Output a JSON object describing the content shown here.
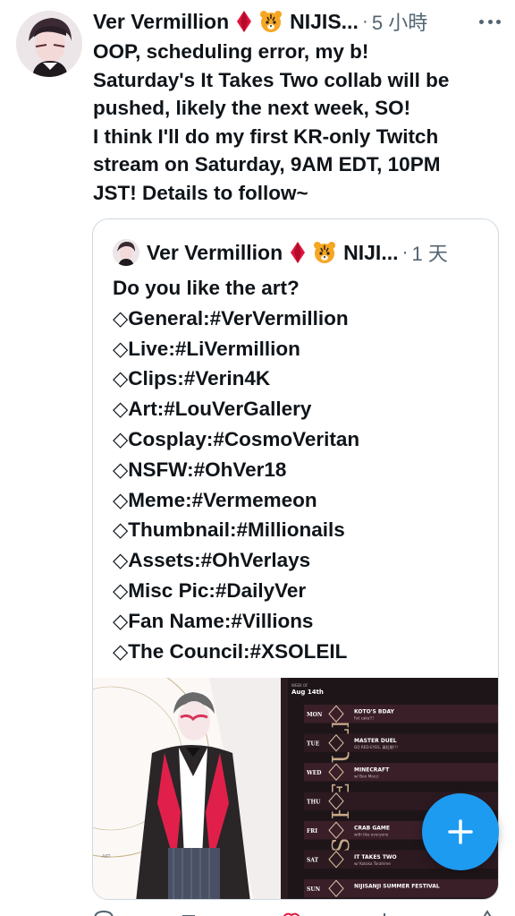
{
  "tweet": {
    "author": "Ver Vermillion",
    "author_trunc": "NIJIS...",
    "separator": "·",
    "time": "5 小時",
    "lines": [
      "OOP, scheduling error, my b!",
      "Saturday's It Takes Two collab will be",
      "pushed, likely the next week, SO!",
      "I think I'll do my first KR-only Twitch",
      "stream on Saturday, 9AM EDT, 10PM",
      "JST! Details to follow~"
    ]
  },
  "quote": {
    "author": "Ver Vermillion",
    "author_trunc": "NIJI...",
    "separator": "·",
    "time": "1 天",
    "lines": [
      "Do you like the art?",
      "◇General:#VerVermillion",
      "◇Live:#LiVermillion",
      "◇Clips:#Verin4K",
      "◇Art:#LouVerGallery",
      "◇Cosplay:#CosmoVeritan",
      "◇NSFW:#OhVer18",
      "◇Meme:#Vermemeon",
      "◇Thumbnail:#Millionails",
      "◇Assets:#OhVerlays",
      "◇Misc Pic:#DailyVer",
      "◇Fan Name:#Villions",
      "◇The Council:#XSOLEIL"
    ],
    "schedule": {
      "week_label": "WEEK OF",
      "week_date": "Aug 14th",
      "side_text": "SCHEDULE",
      "days": [
        {
          "day": "MON",
          "title": "KOTO'S BDAY",
          "sub": "Fat cake!!!"
        },
        {
          "day": "TUE",
          "title": "MASTER DUEL",
          "sub": "GO RED-EYES, 真紅眼!!!"
        },
        {
          "day": "WED",
          "title": "MINECRAFT",
          "sub": "w/ Bon Mocci"
        },
        {
          "day": "THU",
          "title": "",
          "sub": ""
        },
        {
          "day": "FRI",
          "title": "CRAB GAME",
          "sub": "with like everyone"
        },
        {
          "day": "SAT",
          "title": "IT TAKES TWO",
          "sub": "w/ Kotoka Torahime"
        },
        {
          "day": "SUN",
          "title": "NIJISANJI SUMMER FESTIVAL",
          "sub": ""
        }
      ]
    }
  },
  "colors": {
    "accent": "#1d9bf0",
    "secondary_text": "#536471",
    "border": "#cfd9de",
    "ruby": "#e2133c"
  },
  "icons": [
    "more-icon",
    "ruby-diamond-icon",
    "tiger-icon",
    "compose-plus-icon"
  ]
}
